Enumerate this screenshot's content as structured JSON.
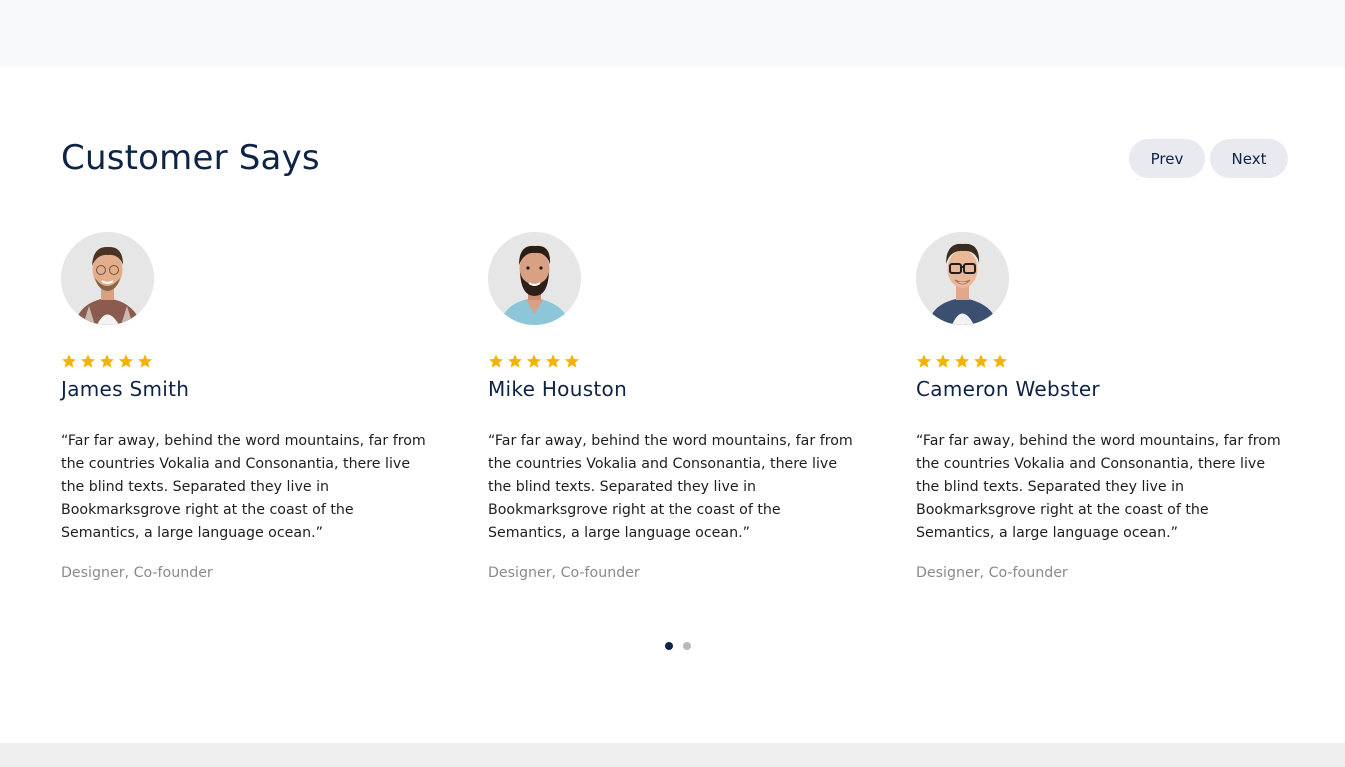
{
  "section": {
    "title": "Customer Says",
    "prev_label": "Prev",
    "next_label": "Next"
  },
  "colors": {
    "heading": "#0f2346",
    "star": "#f5b301",
    "muted": "#8a8a8a",
    "button_bg": "#e8eaef"
  },
  "testimonials": [
    {
      "name": "James Smith",
      "rating": 5,
      "quote": "“Far far away, behind the word mountains, far from the countries Vokalia and Consonantia, there live the blind texts. Separated they live in Bookmarksgrove right at the coast of the Semantics, a large language ocean.”",
      "role": "Designer, Co-founder"
    },
    {
      "name": "Mike Houston",
      "rating": 5,
      "quote": "“Far far away, behind the word mountains, far from the countries Vokalia and Consonantia, there live the blind texts. Separated they live in Bookmarksgrove right at the coast of the Semantics, a large language ocean.”",
      "role": "Designer, Co-founder"
    },
    {
      "name": "Cameron Webster",
      "rating": 5,
      "quote": "“Far far away, behind the word mountains, far from the countries Vokalia and Consonantia, there live the blind texts. Separated they live in Bookmarksgrove right at the coast of the Semantics, a large language ocean.”",
      "role": "Designer, Co-founder"
    }
  ],
  "pagination": {
    "total": 2,
    "active": 1
  }
}
